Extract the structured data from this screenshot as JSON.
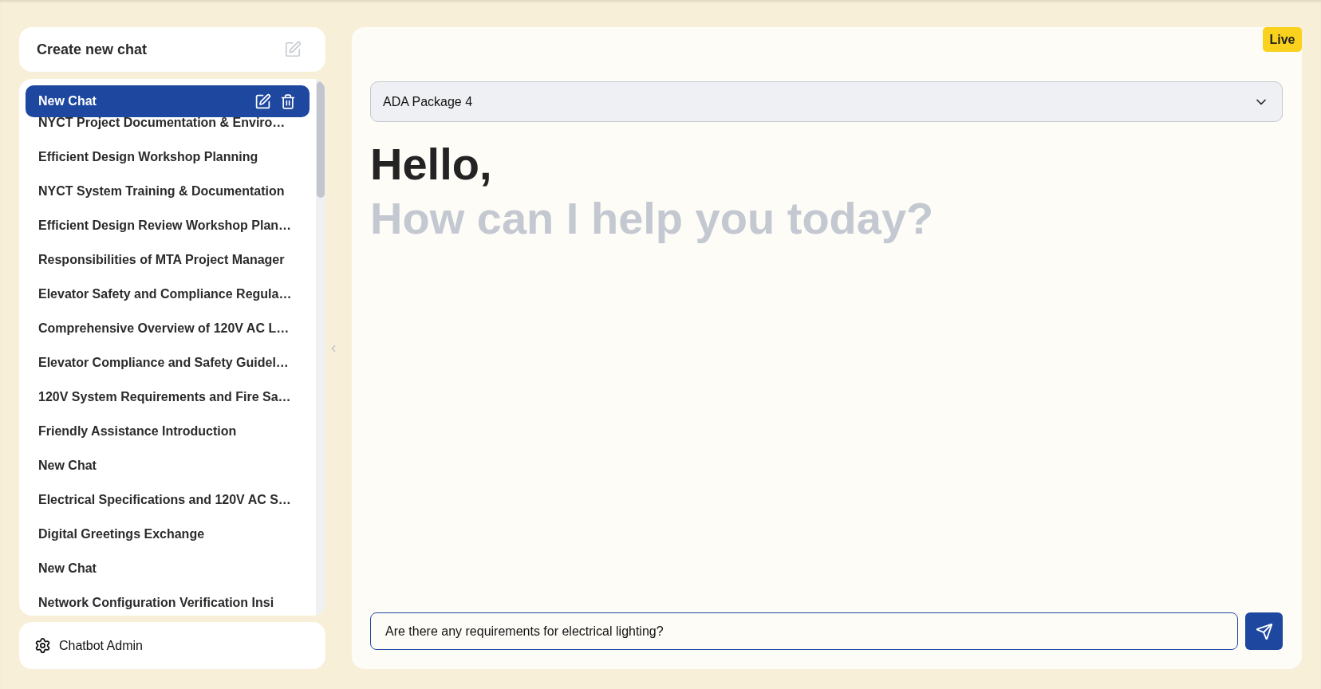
{
  "sidebar": {
    "new_chat_button": {
      "label": "Create new chat"
    },
    "chats": [
      {
        "title": "New Chat",
        "selected": true
      },
      {
        "title": "NYCT Project Documentation & Enviro…",
        "selected": false
      },
      {
        "title": "Efficient Design Workshop Planning",
        "selected": false
      },
      {
        "title": "NYCT System Training & Documentation",
        "selected": false
      },
      {
        "title": "Efficient Design Review Workshop Plan…",
        "selected": false
      },
      {
        "title": "Responsibilities of MTA Project Manager",
        "selected": false
      },
      {
        "title": "Elevator Safety and Compliance Regula…",
        "selected": false
      },
      {
        "title": "Comprehensive Overview of 120V AC L…",
        "selected": false
      },
      {
        "title": "Elevator Compliance and Safety Guidel…",
        "selected": false
      },
      {
        "title": "120V System Requirements and Fire Sa…",
        "selected": false
      },
      {
        "title": "Friendly Assistance Introduction",
        "selected": false
      },
      {
        "title": "New Chat",
        "selected": false
      },
      {
        "title": "Electrical Specifications and 120V AC S…",
        "selected": false
      },
      {
        "title": "Digital Greetings Exchange",
        "selected": false
      },
      {
        "title": "New Chat",
        "selected": false
      },
      {
        "title": "Network Configuration Verification Insi",
        "selected": false
      }
    ],
    "admin_link": {
      "label": "Chatbot Admin"
    }
  },
  "main": {
    "status_badge": "Live",
    "package_select": {
      "value": "ADA Package 4"
    },
    "greeting": "Hello,",
    "prompt": "How can I help you today?",
    "message_input": {
      "value": "Are there any requirements for electrical lighting?"
    }
  }
}
